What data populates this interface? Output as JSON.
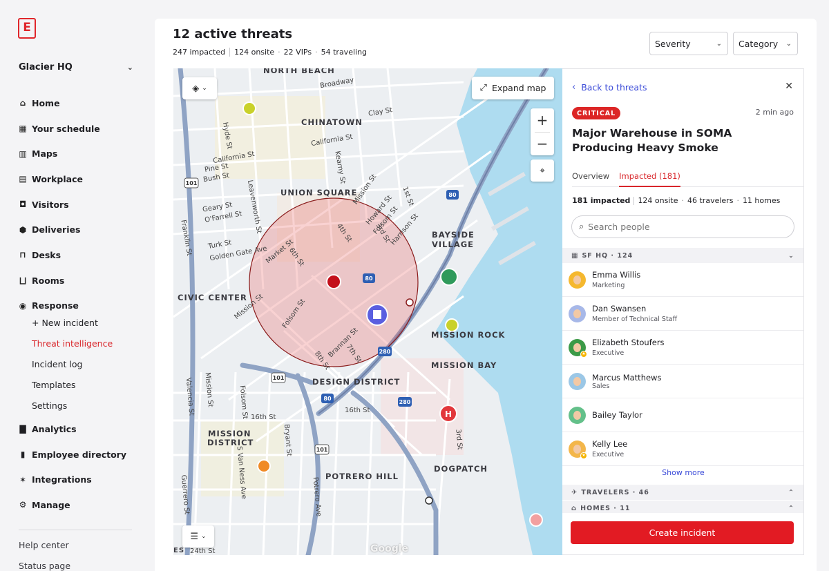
{
  "brand": {
    "logo_letter": "E",
    "accent": "#e0262b"
  },
  "sidebar": {
    "org_name": "Glacier HQ",
    "items": [
      {
        "label": "Home",
        "icon": "home-icon"
      },
      {
        "label": "Your schedule",
        "icon": "calendar-icon"
      },
      {
        "label": "Maps",
        "icon": "map-icon"
      },
      {
        "label": "Workplace",
        "icon": "grid-icon"
      },
      {
        "label": "Visitors",
        "icon": "visitor-icon"
      },
      {
        "label": "Deliveries",
        "icon": "package-icon"
      },
      {
        "label": "Desks",
        "icon": "desk-icon"
      },
      {
        "label": "Rooms",
        "icon": "sofa-icon"
      },
      {
        "label": "Response",
        "icon": "broadcast-icon"
      }
    ],
    "response_sub": [
      {
        "label": "+ New incident"
      },
      {
        "label": "Threat intelligence",
        "active": true
      },
      {
        "label": "Incident log"
      },
      {
        "label": "Templates"
      },
      {
        "label": "Settings"
      }
    ],
    "items2": [
      {
        "label": "Analytics",
        "icon": "bar-chart-icon"
      },
      {
        "label": "Employee directory",
        "icon": "book-icon"
      },
      {
        "label": "Integrations",
        "icon": "integrations-icon"
      },
      {
        "label": "Manage",
        "icon": "gear-icon"
      }
    ],
    "footer": {
      "help": "Help center",
      "status": "Status page"
    }
  },
  "header": {
    "title": "12 active threats",
    "stats": {
      "impacted": "247 impacted",
      "onsite": "124 onsite",
      "vips": "22 VIPs",
      "traveling": "54 traveling"
    },
    "filters": {
      "severity": "Severity",
      "category": "Category"
    }
  },
  "map": {
    "expand_label": "Expand map",
    "attribution": "Google",
    "neighborhoods": {
      "north_beach": "NORTH BEACH",
      "chinatown": "CHINATOWN",
      "union_square": "UNION SQUARE",
      "bayside_village": "BAYSIDE",
      "bayside_village2": "VILLAGE",
      "civic_center": "CIVIC CENTER",
      "mission_rock": "MISSION ROCK",
      "mission_bay": "MISSION BAY",
      "design_district": "DESIGN DISTRICT",
      "mission_district": "MISSION",
      "mission_district2": "DISTRICT",
      "potrero_hill": "POTRERO HILL",
      "dogpatch": "DOGPATCH"
    },
    "streets": {
      "broadway": "Broadway",
      "clay": "Clay St",
      "hyde": "Hyde St",
      "california1": "California St",
      "california2": "California St",
      "kearny": "Kearny St",
      "pine": "Pine St",
      "bush": "Bush St",
      "leavenworth": "Leavenworth St",
      "mission": "Mission St",
      "first": "1st St",
      "howard": "Howard St",
      "folsom_n": "Folsom St",
      "harrison": "Harrison St",
      "third_n": "3rd St",
      "geary": "Geary St",
      "ofarrell": "O'Farrell St",
      "franklin": "Franklin St",
      "turk": "Turk St",
      "golden_gate": "Golden Gate Ave",
      "market": "Market St",
      "sixth": "6th St",
      "fourth": "4th St",
      "mission2": "Mission St",
      "folsom_s": "Folsom St",
      "brannan": "Brannan St",
      "seventh": "7th St",
      "eighth": "8th St",
      "valencia": "Valencia St",
      "mission3": "Mission St",
      "folsom3": "Folsom St",
      "sixteenth1": "16th St",
      "sixteenth2": "16th St",
      "bryant": "Bryant St",
      "s_van_ness": "S Van Ness Ave",
      "potrero": "Potrero Ave",
      "guerrero": "Guerrero St",
      "third_s": "3rd St",
      "twentyfourth": "24th St",
      "es": "ES"
    },
    "highways": [
      "101",
      "80",
      "280"
    ]
  },
  "panel": {
    "back_label": "Back to threats",
    "severity_badge": "CRITICAL",
    "time": "2 min ago",
    "title": "Major Warehouse in SOMA Producing Heavy Smoke",
    "tabs": {
      "overview": "Overview",
      "impacted": "Impacted (181)"
    },
    "stats": {
      "impacted": "181 impacted",
      "onsite": "124 onsite",
      "travelers": "46 travelers",
      "homes": "11 homes"
    },
    "search_placeholder": "Search people",
    "groups": {
      "hq": "SF HQ · 124",
      "travelers": "TRAVELERS · 46",
      "homes": "HOMES · 11"
    },
    "people": [
      {
        "name": "Emma Willis",
        "role": "Marketing",
        "vip": false,
        "avatar_bg": "#f5b82e"
      },
      {
        "name": "Dan Swansen",
        "role": "Member of Technical Staff",
        "vip": false,
        "avatar_bg": "#a7b8e8"
      },
      {
        "name": "Elizabeth Stoufers",
        "role": "Executive",
        "vip": true,
        "avatar_bg": "#3c9a47"
      },
      {
        "name": "Marcus Matthews",
        "role": "Sales",
        "vip": false,
        "avatar_bg": "#9bc7e6"
      },
      {
        "name": "Bailey Taylor",
        "role": "",
        "vip": false,
        "avatar_bg": "#64c08a"
      },
      {
        "name": "Kelly Lee",
        "role": "Executive",
        "vip": true,
        "avatar_bg": "#f3b64a"
      }
    ],
    "show_more": "Show more",
    "cta": "Create incident"
  }
}
